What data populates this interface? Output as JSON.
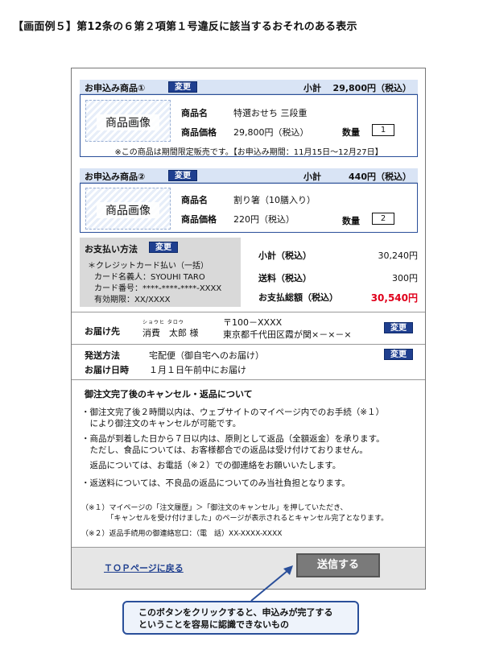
{
  "heading": "【画面例５】第12条の６第２項第１号違反に該当するおそれのある表示",
  "product1": {
    "title": "お申込み商品①",
    "change": "変更",
    "subtotal_label": "小計",
    "subtotal_value": "29,800円（税込）",
    "image_label": "商品画像",
    "name_label": "商品名",
    "name_value": "特選おせち 三段重",
    "price_label": "商品価格",
    "price_value": "29,800円（税込）",
    "qty_label": "数量",
    "qty_value": "1",
    "notice": "※この商品は期間限定販売です。【お申込み期間：11月15日〜12月27日】"
  },
  "product2": {
    "title": "お申込み商品②",
    "change": "変更",
    "subtotal_label": "小計",
    "subtotal_value": "440円（税込）",
    "image_label": "商品画像",
    "name_label": "商品名",
    "name_value": "割り箸（10膳入り）",
    "price_label": "商品価格",
    "price_value": "220円（税込）",
    "qty_label": "数量",
    "qty_value": "2"
  },
  "payment": {
    "title": "お支払い方法",
    "change": "変更",
    "method": "＊クレジットカード払い（一括）",
    "holder": "カード名義人：SYOUHI TARO",
    "number": "カード番号：****-****-****-XXXX",
    "expiry": "有効期限：XX/XXXX"
  },
  "summary": {
    "subtotal_label": "小計（税込）",
    "subtotal_value": "30,240円",
    "shipping_label": "送料（税込）",
    "shipping_value": "300円",
    "total_label": "お支払総額（税込）",
    "total_value": "30,540円"
  },
  "delivery": {
    "label": "お届け先",
    "ruby": "ショウヒ タロウ",
    "name": "消費　太郎 様",
    "postal": "〒100－XXXX",
    "address": "東京都千代田区霞が関×－×－×",
    "change": "変更"
  },
  "shipping": {
    "method_label": "発送方法",
    "method_value": "宅配便（御自宅へのお届け）",
    "date_label": "お届け日時",
    "date_value": "１月１日午前中にお届け",
    "change": "変更"
  },
  "cancel": {
    "title": "御注文完了後のキャンセル・返品について",
    "p1a": "・御注文完了後２時間以内は、ウェブサイトのマイページ内でのお手続（※１）",
    "p1b": "　により御注文のキャンセルが可能です。",
    "p2a": "・商品が到着した日から７日以内は、原則として返品（全額返金）を承ります。",
    "p2b": "　ただし、食品については、お客様都合での返品は受け付けておりません。",
    "p3": "　返品については、お電話（※２）での御連絡をお願いいたします。",
    "p4": "・返送料については、不良品の返品についてのみ当社負担となります。",
    "n1a": "（※１）マイページの「注文履歴」＞「御注文のキャンセル」を押していただき、",
    "n1b": "　　　　「キャンセルを受け付けました」のページが表示されるとキャンセル完了となります。",
    "n2": "（※２）返品手続用の御連絡窓口：（電　話）XX-XXXX-XXXX"
  },
  "footer": {
    "top_link": "ＴＯＰページに戻る",
    "send": "送信する"
  },
  "callout": {
    "line1": "このボタンをクリックすると、申込みが完了する",
    "line2": "ということを容易に認識できないもの"
  },
  "colors": {
    "accent": "#1f3f8f",
    "header_bg": "#d9e4f5",
    "total_red": "#e0001b",
    "button_gray": "#7a7a7a"
  }
}
